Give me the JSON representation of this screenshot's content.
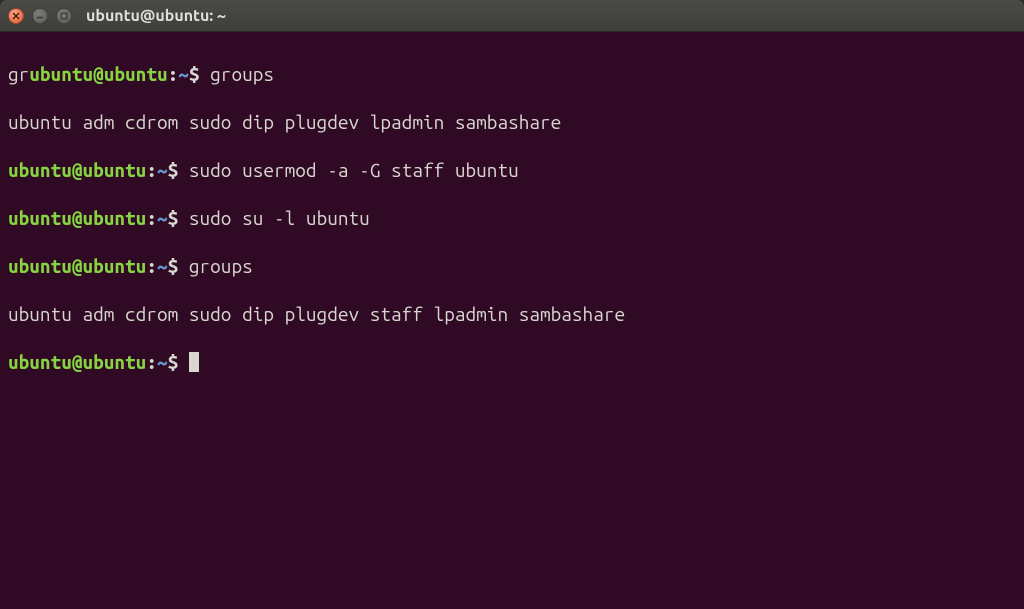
{
  "window": {
    "title": "ubuntu@ubuntu: ~"
  },
  "prompt": {
    "gr_prefix": "gr",
    "userhost": "ubuntu@ubuntu",
    "sep": ":",
    "path": "~",
    "dollar": "$"
  },
  "lines": {
    "cmd0": " groups",
    "out0": "ubuntu adm cdrom sudo dip plugdev lpadmin sambashare",
    "cmd1": " sudo usermod -a -G staff ubuntu",
    "cmd2": " sudo su -l ubuntu",
    "cmd3": " groups",
    "out1": "ubuntu adm cdrom sudo dip plugdev staff lpadmin sambashare",
    "cmd4": " "
  }
}
